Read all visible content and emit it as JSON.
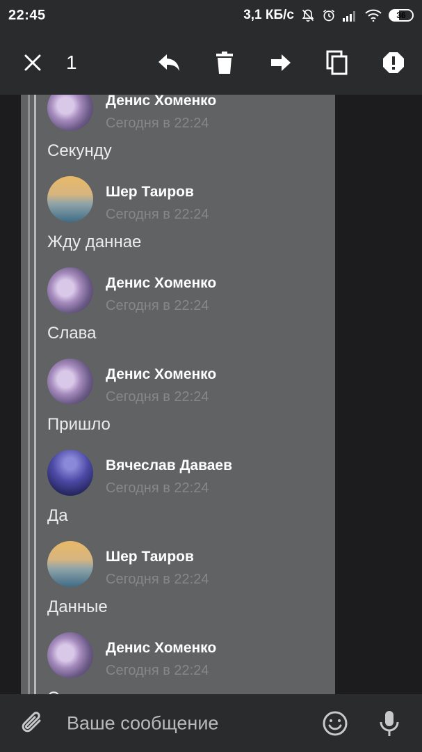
{
  "status_bar": {
    "time": "22:45",
    "network_speed": "3,1 КБ/с",
    "battery_level": "36",
    "icons": [
      "bell-off-icon",
      "alarm-icon",
      "signal-icon",
      "wifi-icon",
      "battery-icon"
    ]
  },
  "action_bar": {
    "selected_count": "1",
    "icons": [
      "close-icon",
      "reply-icon",
      "delete-icon",
      "forward-icon",
      "copy-icon",
      "report-icon"
    ]
  },
  "messages": [
    {
      "author": "Денис Хоменко",
      "time": "Сегодня в 22:24",
      "text": "Секунду",
      "avatar": "purple"
    },
    {
      "author": "Шер Таиров",
      "time": "Сегодня в 22:24",
      "text": "Жду даннае",
      "avatar": "sunset"
    },
    {
      "author": "Денис Хоменко",
      "time": "Сегодня в 22:24",
      "text": "Слава",
      "avatar": "purple"
    },
    {
      "author": "Денис Хоменко",
      "time": "Сегодня в 22:24",
      "text": "Пришло",
      "avatar": "purple"
    },
    {
      "author": "Вячеслав Даваев",
      "time": "Сегодня в 22:24",
      "text": "Да",
      "avatar": "night"
    },
    {
      "author": "Шер Таиров",
      "time": "Сегодня в 22:24",
      "text": "Данные",
      "avatar": "sunset"
    },
    {
      "author": "Денис Хоменко",
      "time": "Сегодня в 22:24",
      "text": "Ок",
      "avatar": "purple"
    }
  ],
  "input_bar": {
    "placeholder": "Ваше сообщение",
    "icons": [
      "attach-icon",
      "emoji-icon",
      "microphone-icon"
    ]
  },
  "colors": {
    "bar_background": "#2a2b2d",
    "panel_background": "#616264",
    "time_text": "#85878a"
  }
}
